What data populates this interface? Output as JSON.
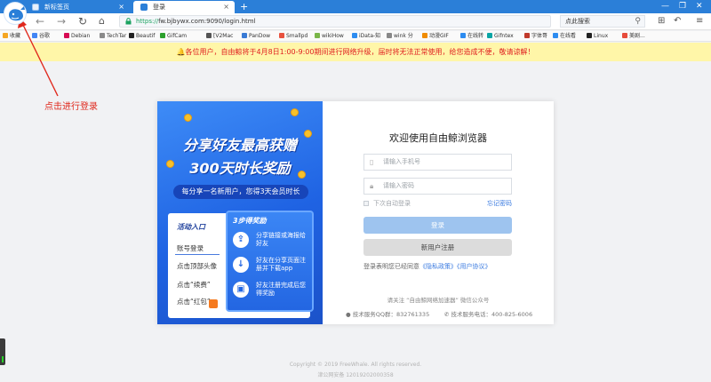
{
  "tabs": [
    {
      "label": "新标签页",
      "close": "×"
    },
    {
      "label": "登录",
      "close": "×"
    }
  ],
  "new_tab": "+",
  "window_controls": [
    "—",
    "❐",
    "✕"
  ],
  "toolbar": {
    "url_scheme": "https://",
    "url_rest": "fw.bjbywx.com:9090/login.html",
    "search_placeholder": "点此搜索",
    "search_icon": "search-icon"
  },
  "bookmarks": [
    {
      "label": "收藏",
      "color": "#f5a623"
    },
    {
      "label": "谷歌",
      "color": "#4285f4"
    },
    {
      "label": "Debian",
      "color": "#d70a53"
    },
    {
      "label": "TechTar",
      "color": "#8a8a8a"
    },
    {
      "label": "Beautif",
      "color": "#222222"
    },
    {
      "label": "GifCam",
      "color": "#2ca02c"
    },
    {
      "label": "[V2Mac",
      "color": "#555555"
    },
    {
      "label": "PanDow",
      "color": "#3a7bd5"
    },
    {
      "label": "Smallpd",
      "color": "#e8523f"
    },
    {
      "label": "wikiHow",
      "color": "#7ab648"
    },
    {
      "label": "iData-知",
      "color": "#2d8cf0"
    },
    {
      "label": "wink 分",
      "color": "#888888"
    },
    {
      "label": "动漫GIF",
      "color": "#f08c00"
    },
    {
      "label": "在线转",
      "color": "#2d8cf0"
    },
    {
      "label": "Gifntex",
      "color": "#0aa5a5"
    },
    {
      "label": "字体哥",
      "color": "#c0392b"
    },
    {
      "label": "在线看",
      "color": "#2d8cf0"
    },
    {
      "label": "Linux",
      "color": "#222222"
    },
    {
      "label": "美剧...",
      "color": "#e74c3c"
    }
  ],
  "notice": "🔔各位用户，自由鲸将于4月8日1:00-9:00期间进行网络升级，届时将无法正常使用，给您造成不便，敬请谅解！",
  "annotation": "点击进行登录",
  "promo": {
    "headline_1": "分享好友最高获赠",
    "headline_2": "300天时长奖励",
    "sub": "每分享一名新用户，您得3天会员时长",
    "entry_title": "活动入口",
    "entries": [
      "账号登录",
      "点击顶部头像",
      "点击“续费”",
      "点击“红包”"
    ],
    "steps_title": "3步得奖励",
    "steps": [
      "分享链接或海报给好友",
      "好友在分享页面注册并下载app",
      "好友注册完成后您得奖励"
    ]
  },
  "login": {
    "title": "欢迎使用自由鲸浏览器",
    "phone_placeholder": "请输入手机号",
    "password_placeholder": "请输入密码",
    "auto_login": "下次自动登录",
    "forgot": "忘记密码",
    "login_button": "登录",
    "register_button": "新用户注册",
    "agree_prefix": "登录表明您已经同意",
    "privacy": "《隐私政策》",
    "terms": "《用户协议》",
    "follow": "请关注 “自由鲸网络加速器” 微信公众号",
    "qq": "技术服务QQ群：832761335",
    "phone": "技术服务电话：400-825-6006"
  },
  "footer": {
    "copyright": "Copyright © 2019 FreeWhale. All rights reserved.",
    "icp": "津公网安备 12019202000358"
  }
}
